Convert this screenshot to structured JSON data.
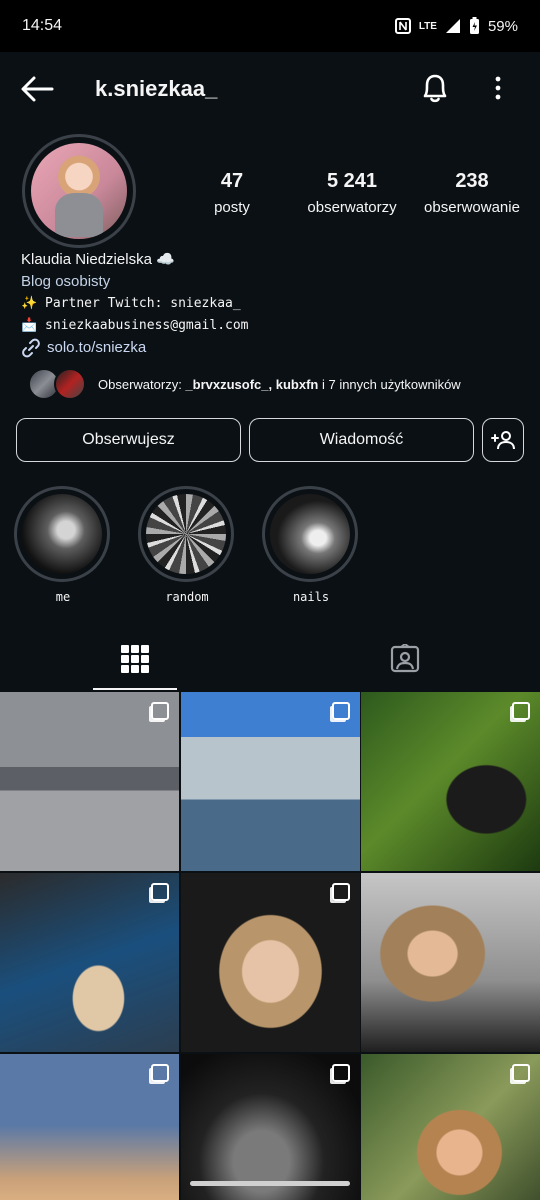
{
  "status_bar": {
    "time": "14:54",
    "network": "LTE",
    "battery": "59%"
  },
  "header": {
    "username": "k.sniezkaa_"
  },
  "stats": [
    {
      "value": "47",
      "label": "posty"
    },
    {
      "value": "5 241",
      "label": "obserwatorzy"
    },
    {
      "value": "238",
      "label": "obserwowanie"
    }
  ],
  "bio": {
    "name": "Klaudia Niedzielska ☁️",
    "category": "Blog osobisty",
    "line1": "✨ Partner Twitch: sniezkaa_",
    "line2": "📩 sniezkaabusiness@gmail.com",
    "link": "solo.to/sniezka"
  },
  "followed_by": {
    "prefix": "Obserwatorzy: ",
    "names": "_brvxzusofc_, kubxfn",
    "suffix": " i 7 innych użytkowników"
  },
  "actions": {
    "follow": "Obserwujesz",
    "message": "Wiadomość"
  },
  "highlights": [
    {
      "label": "me"
    },
    {
      "label": "random"
    },
    {
      "label": "nails"
    }
  ],
  "icons": {
    "back": "arrow-left-icon",
    "bell": "bell-icon",
    "more": "more-vertical-icon",
    "grid": "grid-icon",
    "tagged": "tagged-icon",
    "add_person": "add-person-icon",
    "link": "link-icon"
  }
}
